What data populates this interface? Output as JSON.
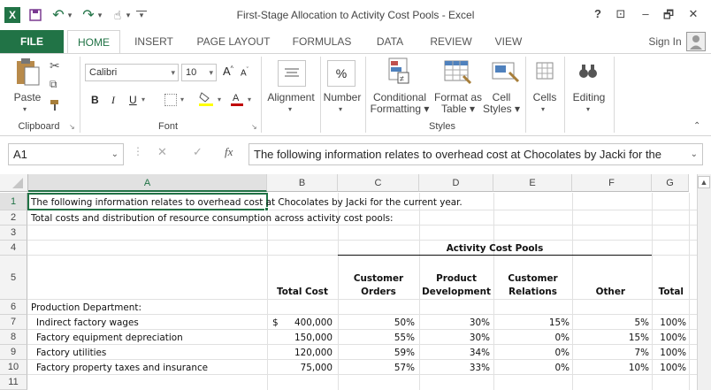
{
  "window": {
    "title": "First-Stage Allocation to Activity Cost Pools - Excel",
    "help": "?",
    "restore_ribbon": "⊡",
    "minimize": "–",
    "maximize": "🗗",
    "close": "✕"
  },
  "qat": {
    "excel_logo": "X",
    "save": "💾",
    "undo": "↶",
    "undo_drop": "▾",
    "redo": "↷",
    "redo_drop": "▾",
    "touch": "☝",
    "touch_drop": "▾",
    "customize": "▾"
  },
  "tabs": [
    "FILE",
    "HOME",
    "INSERT",
    "PAGE LAYOUT",
    "FORMULAS",
    "DATA",
    "REVIEW",
    "VIEW"
  ],
  "sign_in": "Sign In",
  "ribbon": {
    "clipboard": {
      "paste": "Paste",
      "label": "Clipboard"
    },
    "font": {
      "name": "Calibri",
      "size": "10",
      "bold": "B",
      "italic": "I",
      "underline": "U",
      "label": "Font",
      "grow": "A",
      "shrink": "A"
    },
    "alignment": {
      "label": "Alignment"
    },
    "number": {
      "label": "Number",
      "symbol": "%"
    },
    "styles": {
      "conditional_1": "Conditional",
      "conditional_2": "Formatting",
      "format_table_1": "Format as",
      "format_table_2": "Table",
      "cell_styles_1": "Cell",
      "cell_styles_2": "Styles",
      "label": "Styles"
    },
    "cells": {
      "label": "Cells"
    },
    "editing": {
      "label": "Editing"
    }
  },
  "formula_bar": {
    "name_box": "A1",
    "fx": "fx",
    "cancel": "✕",
    "enter": "✓",
    "content": "The following information relates to overhead cost at Chocolates by Jacki for the"
  },
  "columns": [
    "A",
    "B",
    "C",
    "D",
    "E",
    "F",
    "G"
  ],
  "rows": [
    "1",
    "2",
    "3",
    "4",
    "5",
    "6",
    "7",
    "8",
    "9",
    "10",
    "11"
  ],
  "sheet": {
    "r1": "The following information relates to overhead cost at Chocolates by Jacki for the current year.",
    "r2": "Total costs and distribution of resource consumption across activity cost pools:",
    "activity_header": "Activity Cost Pools",
    "headers": {
      "total_cost": "Total Cost",
      "customer_orders_1": "Customer",
      "customer_orders_2": "Orders",
      "product_dev_1": "Product",
      "product_dev_2": "Development",
      "customer_rel_1": "Customer",
      "customer_rel_2": "Relations",
      "other": "Other",
      "total": "Total"
    },
    "r6": "Production Department:",
    "data": [
      {
        "label": "Indirect factory wages",
        "dollar": "$",
        "cost": "400,000",
        "c": "50%",
        "d": "30%",
        "e": "15%",
        "f": "5%",
        "g": "100%"
      },
      {
        "label": "Factory equipment depreciation",
        "dollar": "",
        "cost": "150,000",
        "c": "55%",
        "d": "30%",
        "e": "0%",
        "f": "15%",
        "g": "100%"
      },
      {
        "label": "Factory utilities",
        "dollar": "",
        "cost": "120,000",
        "c": "59%",
        "d": "34%",
        "e": "0%",
        "f": "7%",
        "g": "100%"
      },
      {
        "label": "Factory property taxes and insurance",
        "dollar": "",
        "cost": "75,000",
        "c": "57%",
        "d": "33%",
        "e": "0%",
        "f": "10%",
        "g": "100%"
      }
    ]
  },
  "colors": {
    "excel_green": "#217346",
    "selection": "#217346"
  }
}
